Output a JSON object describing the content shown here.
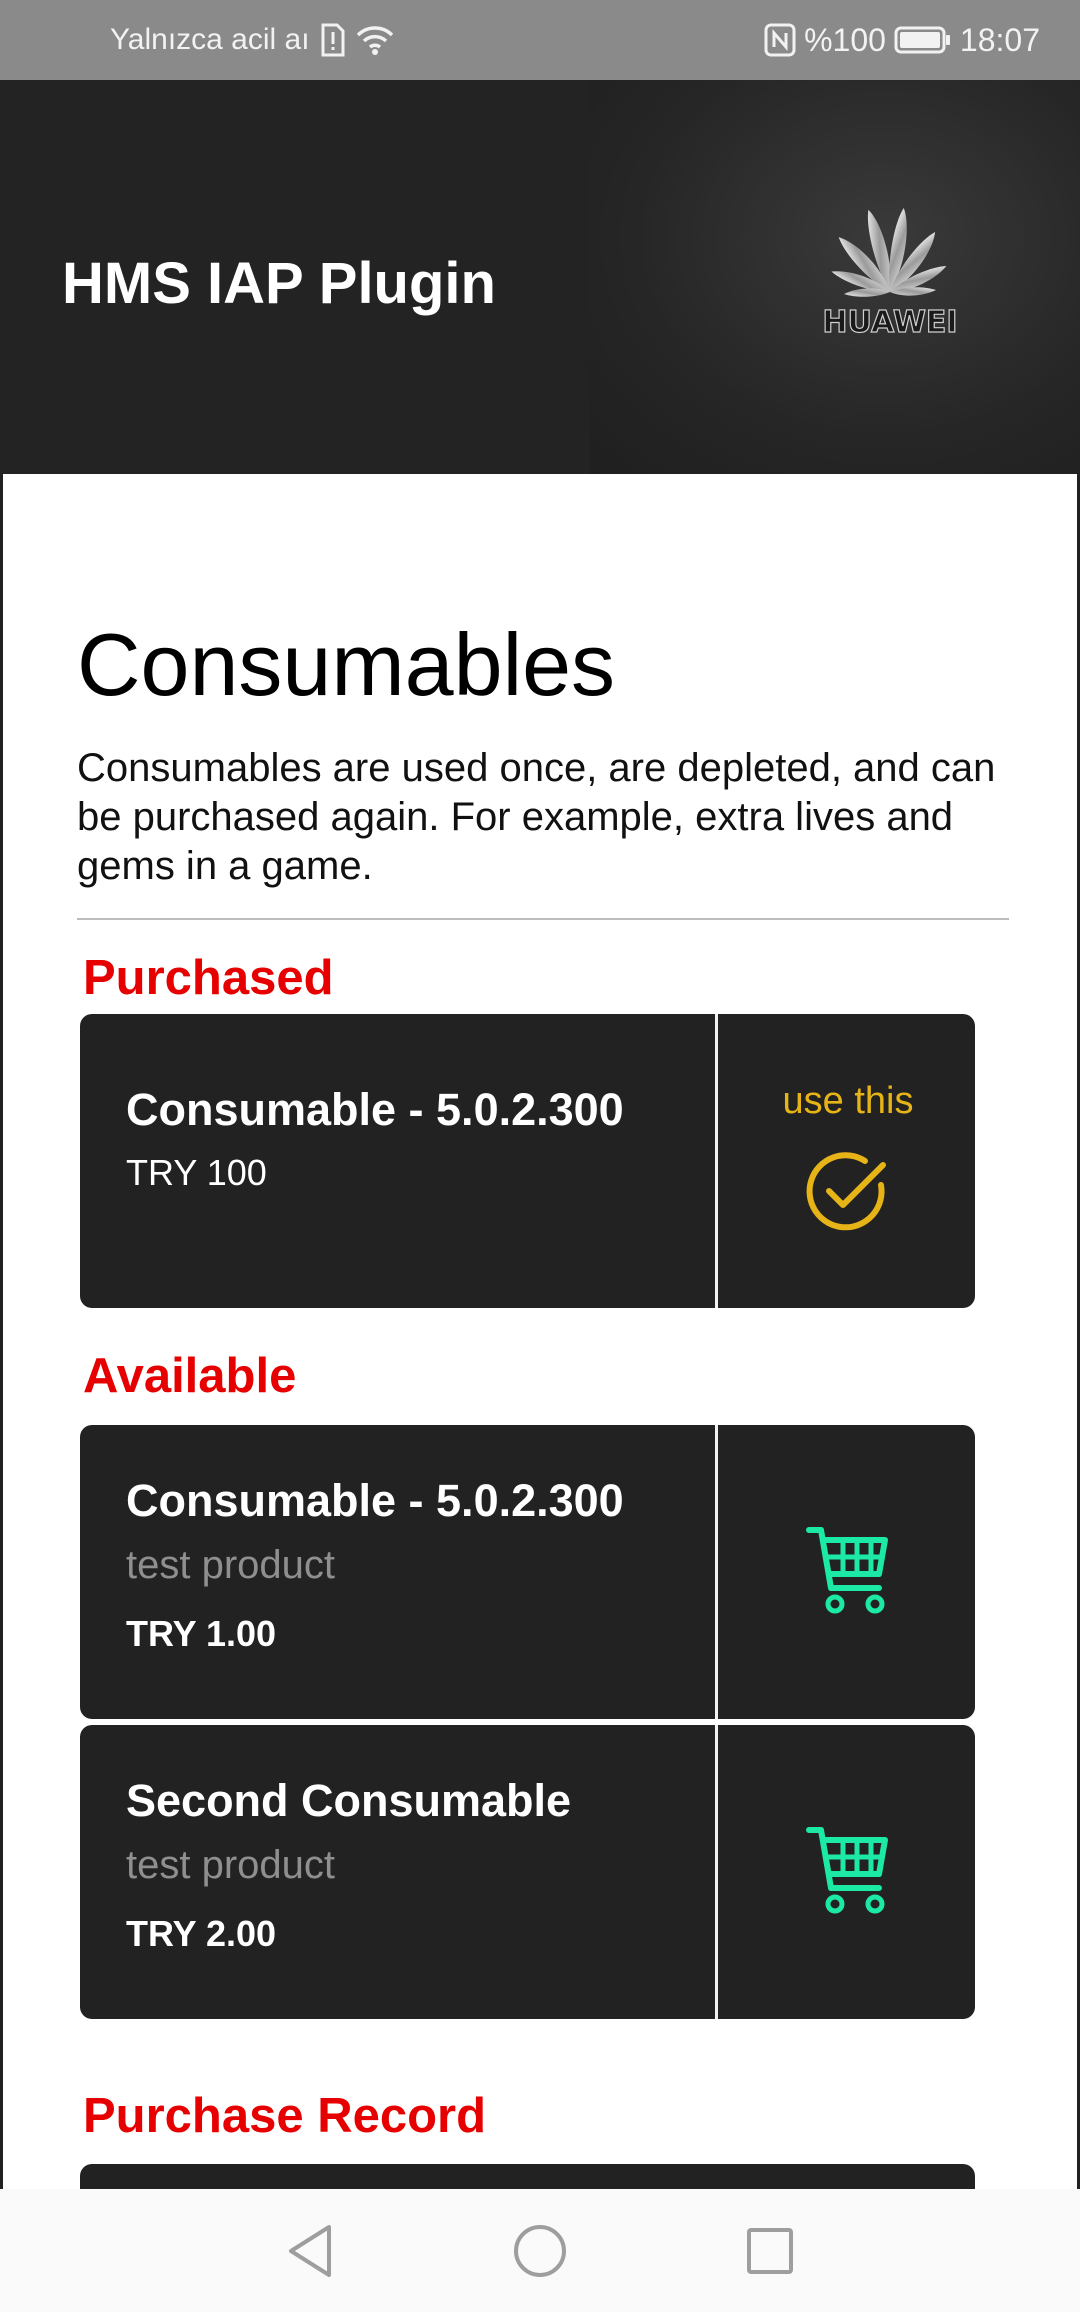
{
  "status_bar": {
    "carrier_text": "Yalnızca acil aı",
    "battery_text": "%100",
    "time": "18:07"
  },
  "app_bar": {
    "title": "HMS IAP Plugin",
    "logo_text": "HUAWEI"
  },
  "page": {
    "heading": "Consumables",
    "description": "Consumables are used once, are depleted, and can be purchased again. For example, extra lives and gems in a game."
  },
  "sections": {
    "purchased_label": "Purchased",
    "available_label": "Available",
    "record_label": "Purchase Record"
  },
  "purchased": [
    {
      "title": "Consumable - 5.0.2.300",
      "price": "TRY  100",
      "action_label": "use this"
    }
  ],
  "available": [
    {
      "title": "Consumable - 5.0.2.300",
      "subtitle": "test product",
      "price": "TRY 1.00"
    },
    {
      "title": "Second Consumable",
      "subtitle": "test product",
      "price": "TRY 2.00"
    }
  ],
  "colors": {
    "section_label": "#e60000",
    "use_accent": "#e6b417",
    "cart_accent": "#1de9a6",
    "card_bg": "#222222"
  },
  "icons": {
    "use": "check-circle-icon",
    "buy": "shopping-cart-icon",
    "nav": [
      "back-icon",
      "home-icon",
      "recents-icon"
    ]
  }
}
